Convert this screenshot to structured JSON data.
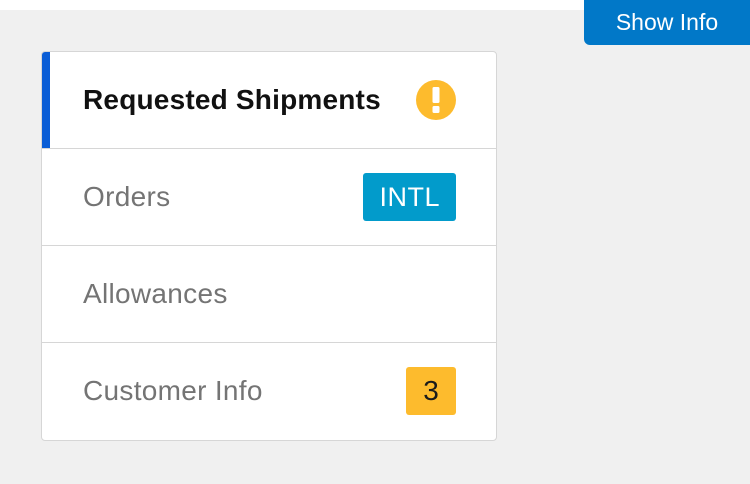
{
  "header": {
    "show_info_label": "Show Info"
  },
  "nav": {
    "items": [
      {
        "label": "Requested Shipments",
        "active": true,
        "badge_icon": "alert-icon"
      },
      {
        "label": "Orders",
        "tag": "INTL"
      },
      {
        "label": "Allowances"
      },
      {
        "label": "Customer Info",
        "count": "3"
      }
    ]
  },
  "colors": {
    "primary_button": "#0178c8",
    "active_indicator": "#0a5dd6",
    "warning": "#fdbb2d",
    "info_tag": "#029bcb"
  }
}
